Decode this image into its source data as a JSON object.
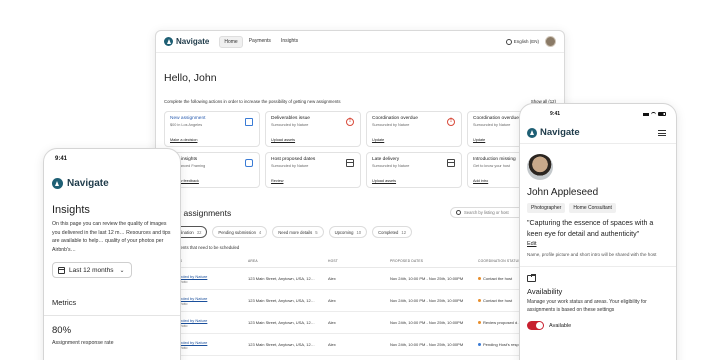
{
  "brand": {
    "name": "Navigate",
    "accent": "#1e5f74"
  },
  "desktop": {
    "nav": [
      "Home",
      "Payments",
      "Insights"
    ],
    "language": "English (EN)",
    "greeting": "Hello, John",
    "intro": "Complete the following actions in order to increase the possibility of getting new assignments",
    "show_all": "Show all (12)",
    "cards": [
      {
        "title": "New assignment",
        "subtitle": "$00 in Los Angeles",
        "link": "Make a decision",
        "icon": "expand-icon",
        "title_color": "#2a5db0"
      },
      {
        "title": "Deliverables issue",
        "subtitle": "Surrounded by Nature",
        "link": "Upload assets",
        "icon": "alert-icon"
      },
      {
        "title": "Coordination overdue",
        "subtitle": "Surrounded by Nature",
        "link": "Update",
        "icon": "alert-icon"
      },
      {
        "title": "Coordination overdue",
        "subtitle": "Surrounded by Nature",
        "link": "Update",
        "icon": "alert-icon"
      },
      {
        "title": "New insights",
        "subtitle": "Unbalanced Framing",
        "link": "Review feedback",
        "icon": "camera-icon"
      },
      {
        "title": "Host proposed dates",
        "subtitle": "Surrounded by Nature",
        "link": "Review",
        "icon": "calendar-icon"
      },
      {
        "title": "Late delivery",
        "subtitle": "Surrounded by Nature",
        "link": "Upload assets",
        "icon": "calendar-icon"
      },
      {
        "title": "Introduction missing",
        "subtitle": "Get to know your host",
        "link": "Add intro",
        "icon": "clock-icon"
      }
    ],
    "assignments": {
      "title": "Your assignments",
      "search_placeholder": "Search by listing or host",
      "filters": [
        {
          "label": "Coordination",
          "count": "32",
          "active": true
        },
        {
          "label": "Pending submission",
          "count": "4"
        },
        {
          "label": "Need more details",
          "count": "5"
        },
        {
          "label": "Upcoming",
          "count": "10"
        },
        {
          "label": "Completed",
          "count": "12"
        }
      ],
      "caption": "Assignments that need to be scheduled",
      "columns": [
        "LISTING",
        "AREA",
        "HOST",
        "PROPOSED DATES",
        "COORDINATION STATUS"
      ],
      "rows": [
        {
          "listing": "Surrounded by Nature",
          "type": "Home Photo",
          "area": "123 Main Street, Anytown, USA, 12…",
          "host": "Alex",
          "dates": "Nov 24th, 10:00 PM - Nov 25th, 10:00PM",
          "status": "Contact the host",
          "dot": "#e88d2a"
        },
        {
          "listing": "Surrounded by Nature",
          "type": "Home Photo",
          "area": "123 Main Street, Anytown, USA, 12…",
          "host": "Alex",
          "dates": "Nov 24th, 10:00 PM - Nov 25th, 10:00PM",
          "status": "Contact the host",
          "dot": "#e88d2a"
        },
        {
          "listing": "Surrounded by Nature",
          "type": "Home Photo",
          "area": "123 Main Street, Anytown, USA, 12…",
          "host": "Alex",
          "dates": "Nov 24th, 10:00 PM - Nov 25th, 10:00PM",
          "status": "Review proposed d…",
          "dot": "#e88d2a"
        },
        {
          "listing": "Surrounded by Nature",
          "type": "Home Photo",
          "area": "123 Main Street, Anytown, USA, 12…",
          "host": "Alex",
          "dates": "Nov 24th, 10:00 PM - Nov 25th, 10:00PM",
          "status": "Pending Host's resp…",
          "dot": "#3a7bd5"
        }
      ]
    }
  },
  "left_phone": {
    "time": "9:41",
    "title": "Insights",
    "description": "On this page you can review the quality of images you delivered in the last 12 m… Resources and tips are available to help… quality of your photos per Airbnb's…",
    "period": "Last 12 months",
    "metrics_title": "Metrics",
    "metric_value": "80%",
    "metric_label": "Assignment response rate"
  },
  "right_phone": {
    "time": "9:41",
    "name": "John Appleseed",
    "tags": [
      "Photographer",
      "Home Consultant"
    ],
    "quote": "\"Capturing the essence of spaces with a keen eye for detail and authenticity\"",
    "edit": "Edit",
    "hint": "Name, profile picture and short intro will be shared with the host",
    "availability_title": "Availability",
    "availability_desc": "Manage your work status and areas. Your eligibility for assignments is based on these settings",
    "toggle_label": "Available"
  }
}
